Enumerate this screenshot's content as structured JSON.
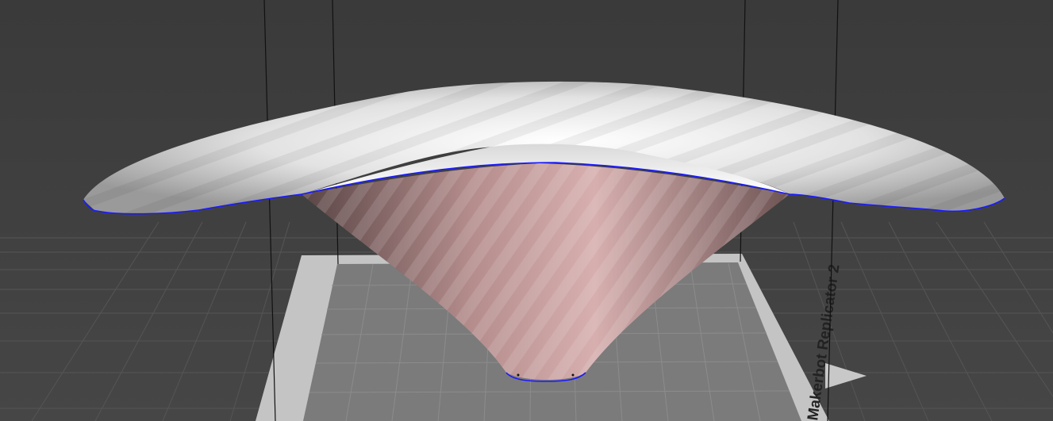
{
  "viewport": {
    "background_color": "#3d3d3d",
    "grid_color": "#555555",
    "build_plate_color": "#7a7a7a",
    "plate_border_color": "#c9c9c9",
    "model_outer_color": "#e8e8e8",
    "model_inner_color": "#c89a9a",
    "outline_color": "#1a1aff"
  },
  "build_plate": {
    "printer_name": "Makerbot Replicator 2",
    "front_marker_icon": "triangle-arrow-icon"
  },
  "model": {
    "icon": "vase-model-icon"
  }
}
